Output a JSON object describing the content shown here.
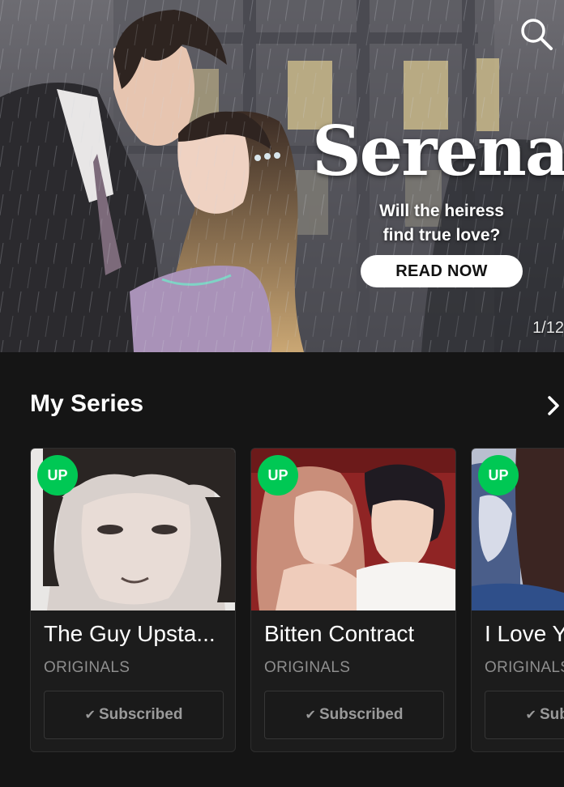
{
  "hero": {
    "title": "Serena",
    "tagline_line1": "Will the heiress",
    "tagline_line2": "find true love?",
    "cta_label": "READ NOW",
    "pager": "1/12"
  },
  "my_series": {
    "heading": "My Series",
    "items": [
      {
        "badge": "UP",
        "title": "The Guy Upsta...",
        "genre": "ORIGINALS",
        "status": "Subscribed"
      },
      {
        "badge": "UP",
        "title": "Bitten Contract",
        "genre": "ORIGINALS",
        "status": "Subscribed"
      },
      {
        "badge": "UP",
        "title": "I Love Y",
        "genre": "ORIGINALS",
        "status": "Subscribed"
      }
    ]
  },
  "colors": {
    "background": "#151515",
    "card": "#1c1c1c",
    "up_badge": "#00c854",
    "muted_text": "#8e8e8e",
    "cta_bg": "#ffffff"
  },
  "icons": {
    "search": "search-icon",
    "more": "chevron-right-icon",
    "check": "check-icon"
  }
}
